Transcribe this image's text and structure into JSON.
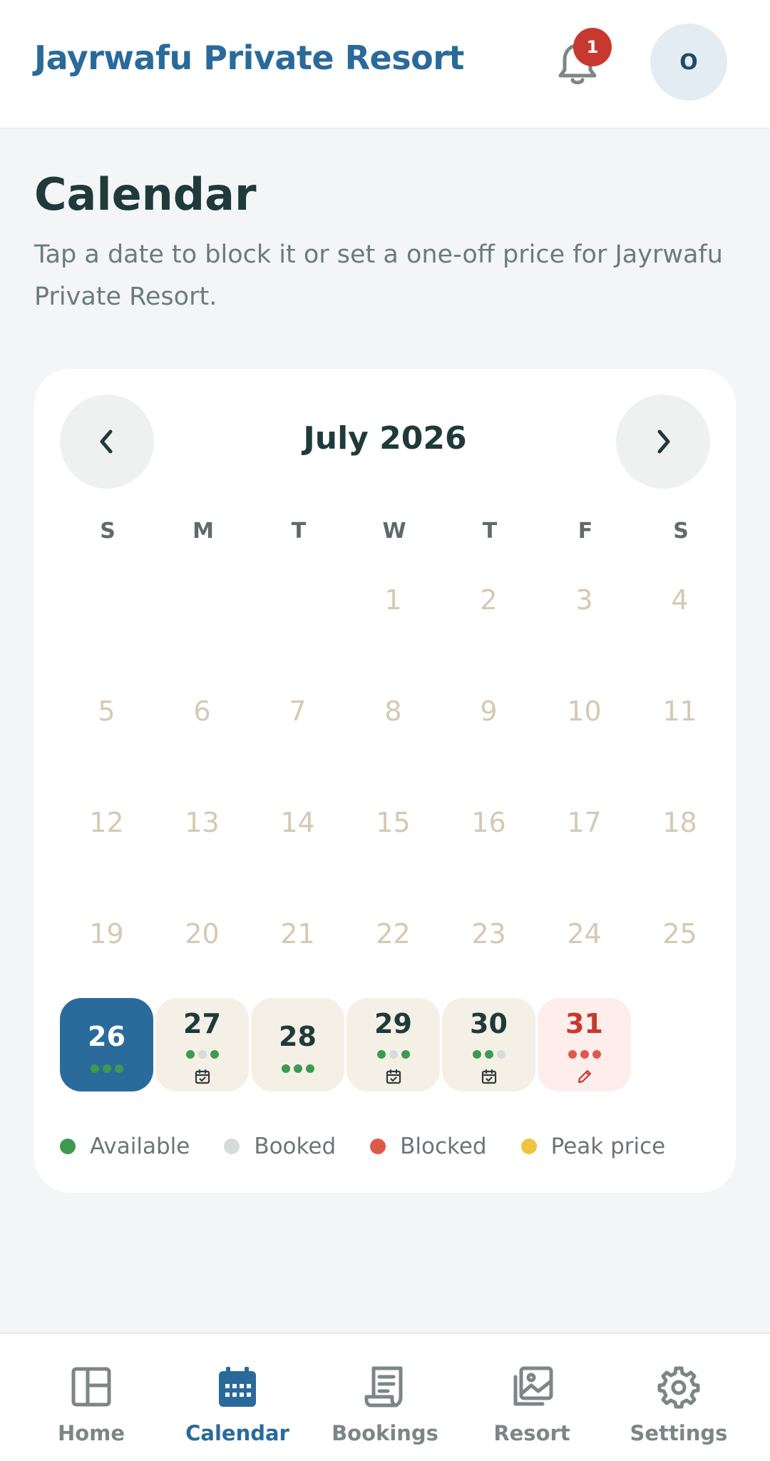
{
  "header": {
    "brand": "Jayrwafu Private Resort",
    "notification_count": "1",
    "avatar_initial": "O"
  },
  "page": {
    "title": "Calendar",
    "subtitle": "Tap a date to block it or set a one-off price for Jayrwafu Private Resort."
  },
  "calendar": {
    "month_label": "July 2026",
    "weekdays": [
      "S",
      "M",
      "T",
      "W",
      "T",
      "F",
      "S"
    ],
    "days": {
      "d1": "1",
      "d2": "2",
      "d3": "3",
      "d4": "4",
      "d5": "5",
      "d6": "6",
      "d7": "7",
      "d8": "8",
      "d9": "9",
      "d10": "10",
      "d11": "11",
      "d12": "12",
      "d13": "13",
      "d14": "14",
      "d15": "15",
      "d16": "16",
      "d17": "17",
      "d18": "18",
      "d19": "19",
      "d20": "20",
      "d21": "21",
      "d22": "22",
      "d23": "23",
      "d24": "24",
      "d25": "25",
      "d26": "26",
      "d27": "27",
      "d28": "28",
      "d29": "29",
      "d30": "30",
      "d31": "31"
    },
    "selected_day": "26",
    "legend": {
      "available": "Available",
      "booked": "Booked",
      "blocked": "Blocked",
      "peak": "Peak price"
    },
    "colors": {
      "available": "#3d9a50",
      "booked": "#d5dcda",
      "blocked": "#dd5a4b",
      "peak": "#f0c443",
      "selected": "#2a6b9b"
    }
  },
  "bottom_nav": {
    "home": "Home",
    "calendar": "Calendar",
    "bookings": "Bookings",
    "resort": "Resort",
    "settings": "Settings",
    "active": "Calendar"
  }
}
